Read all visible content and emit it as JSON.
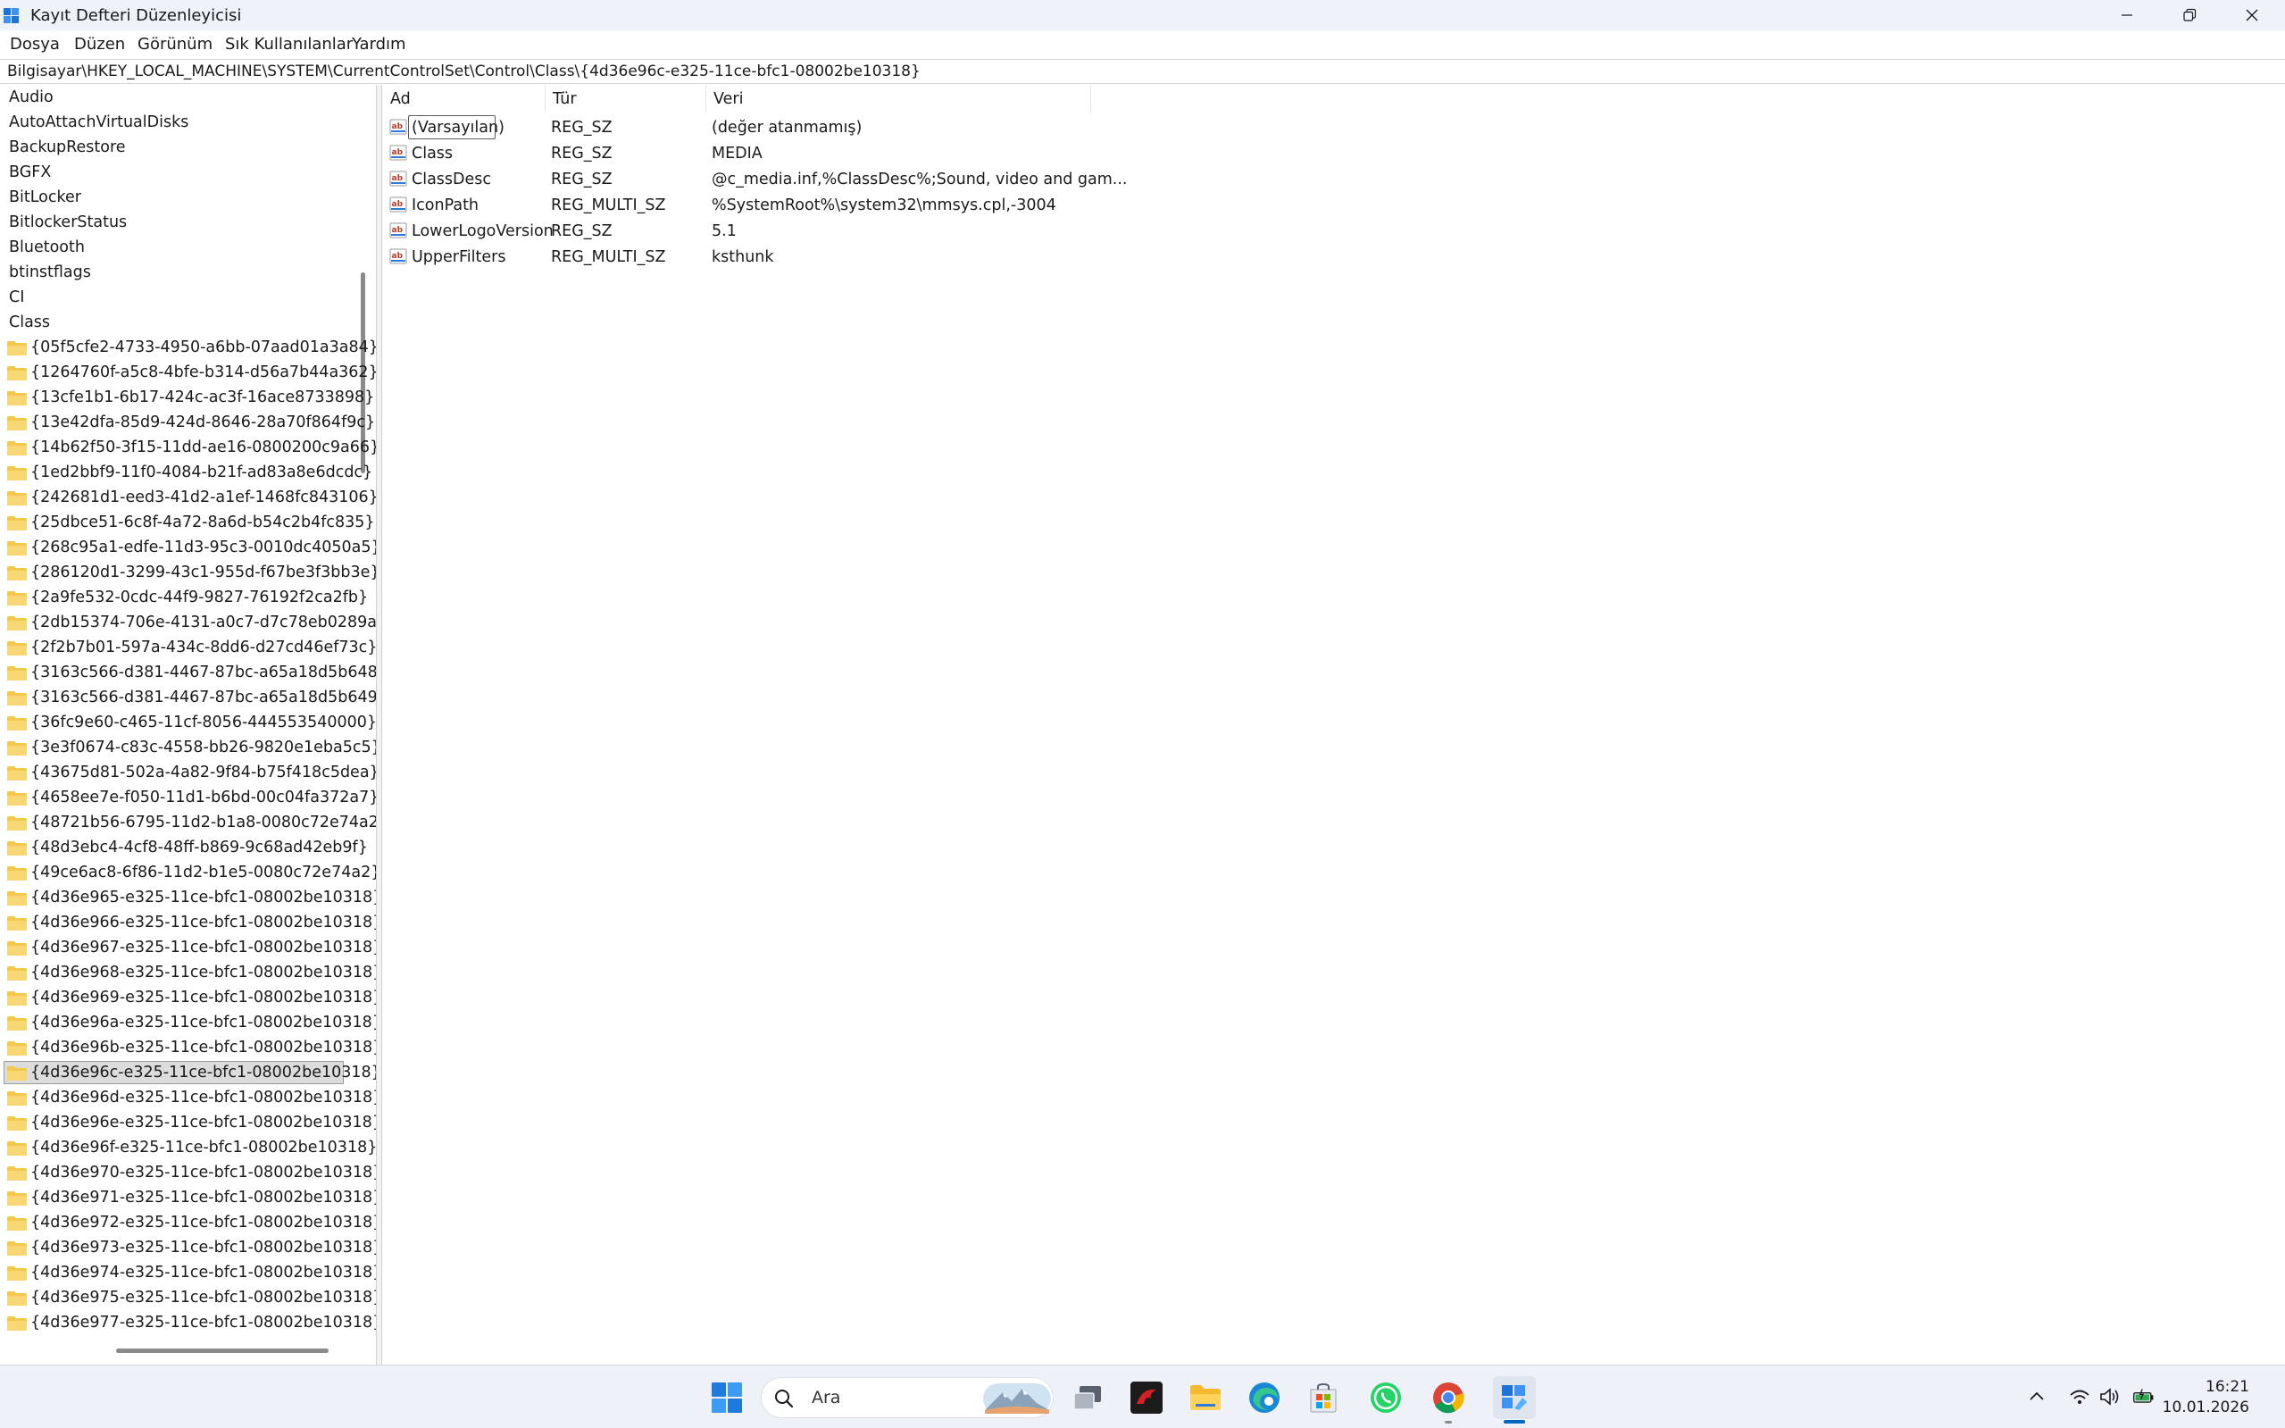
{
  "window": {
    "title": "Kayıt Defteri Düzenleyicisi"
  },
  "menu": {
    "items": [
      "Dosya",
      "Düzen",
      "Görünüm",
      "Sık Kullanılanlar",
      "Yardım"
    ]
  },
  "address": {
    "path": "Bilgisayar\\HKEY_LOCAL_MACHINE\\SYSTEM\\CurrentControlSet\\Control\\Class\\{4d36e96c-e325-11ce-bfc1-08002be10318}"
  },
  "tree": {
    "items": [
      {
        "label": "Audio"
      },
      {
        "label": "AutoAttachVirtualDisks"
      },
      {
        "label": "BackupRestore"
      },
      {
        "label": "BGFX"
      },
      {
        "label": "BitLocker"
      },
      {
        "label": "BitlockerStatus"
      },
      {
        "label": "Bluetooth"
      },
      {
        "label": "btinstflags"
      },
      {
        "label": "CI"
      },
      {
        "label": "Class"
      },
      {
        "label": "{05f5cfe2-4733-4950-a6bb-07aad01a3a84}"
      },
      {
        "label": "{1264760f-a5c8-4bfe-b314-d56a7b44a362}"
      },
      {
        "label": "{13cfe1b1-6b17-424c-ac3f-16ace8733898}"
      },
      {
        "label": "{13e42dfa-85d9-424d-8646-28a70f864f9c}"
      },
      {
        "label": "{14b62f50-3f15-11dd-ae16-0800200c9a66}"
      },
      {
        "label": "{1ed2bbf9-11f0-4084-b21f-ad83a8e6dcdc}"
      },
      {
        "label": "{242681d1-eed3-41d2-a1ef-1468fc843106}"
      },
      {
        "label": "{25dbce51-6c8f-4a72-8a6d-b54c2b4fc835}"
      },
      {
        "label": "{268c95a1-edfe-11d3-95c3-0010dc4050a5}"
      },
      {
        "label": "{286120d1-3299-43c1-955d-f67be3f3bb3e}"
      },
      {
        "label": "{2a9fe532-0cdc-44f9-9827-76192f2ca2fb}"
      },
      {
        "label": "{2db15374-706e-4131-a0c7-d7c78eb0289a}"
      },
      {
        "label": "{2f2b7b01-597a-434c-8dd6-d27cd46ef73c}"
      },
      {
        "label": "{3163c566-d381-4467-87bc-a65a18d5b648}"
      },
      {
        "label": "{3163c566-d381-4467-87bc-a65a18d5b649}"
      },
      {
        "label": "{36fc9e60-c465-11cf-8056-444553540000}"
      },
      {
        "label": "{3e3f0674-c83c-4558-bb26-9820e1eba5c5}"
      },
      {
        "label": "{43675d81-502a-4a82-9f84-b75f418c5dea}"
      },
      {
        "label": "{4658ee7e-f050-11d1-b6bd-00c04fa372a7}"
      },
      {
        "label": "{48721b56-6795-11d2-b1a8-0080c72e74a2}"
      },
      {
        "label": "{48d3ebc4-4cf8-48ff-b869-9c68ad42eb9f}"
      },
      {
        "label": "{49ce6ac8-6f86-11d2-b1e5-0080c72e74a2}"
      },
      {
        "label": "{4d36e965-e325-11ce-bfc1-08002be10318}"
      },
      {
        "label": "{4d36e966-e325-11ce-bfc1-08002be10318}"
      },
      {
        "label": "{4d36e967-e325-11ce-bfc1-08002be10318}"
      },
      {
        "label": "{4d36e968-e325-11ce-bfc1-08002be10318}"
      },
      {
        "label": "{4d36e969-e325-11ce-bfc1-08002be10318}"
      },
      {
        "label": "{4d36e96a-e325-11ce-bfc1-08002be10318}"
      },
      {
        "label": "{4d36e96b-e325-11ce-bfc1-08002be10318}"
      },
      {
        "label": "{4d36e96c-e325-11ce-bfc1-08002be10318}"
      },
      {
        "label": "{4d36e96d-e325-11ce-bfc1-08002be10318}"
      },
      {
        "label": "{4d36e96e-e325-11ce-bfc1-08002be10318}"
      },
      {
        "label": "{4d36e96f-e325-11ce-bfc1-08002be10318}"
      },
      {
        "label": "{4d36e970-e325-11ce-bfc1-08002be10318}"
      },
      {
        "label": "{4d36e971-e325-11ce-bfc1-08002be10318}"
      },
      {
        "label": "{4d36e972-e325-11ce-bfc1-08002be10318}"
      },
      {
        "label": "{4d36e973-e325-11ce-bfc1-08002be10318}"
      },
      {
        "label": "{4d36e974-e325-11ce-bfc1-08002be10318}"
      },
      {
        "label": "{4d36e975-e325-11ce-bfc1-08002be10318}"
      },
      {
        "label": "{4d36e977-e325-11ce-bfc1-08002be10318}"
      }
    ],
    "selected_label": "{4d36e96c-e325-11ce-bfc1-08002be10318}"
  },
  "list": {
    "columns": [
      "Ad",
      "Tür",
      "Veri"
    ],
    "rows": [
      {
        "name": "(Varsayılan)",
        "type": "REG_SZ",
        "data": "(değer atanmamış)"
      },
      {
        "name": "Class",
        "type": "REG_SZ",
        "data": "MEDIA"
      },
      {
        "name": "ClassDesc",
        "type": "REG_SZ",
        "data": "@c_media.inf,%ClassDesc%;Sound, video and gam..."
      },
      {
        "name": "IconPath",
        "type": "REG_MULTI_SZ",
        "data": "%SystemRoot%\\system32\\mmsys.cpl,-3004"
      },
      {
        "name": "LowerLogoVersion",
        "type": "REG_SZ",
        "data": "5.1"
      },
      {
        "name": "UpperFilters",
        "type": "REG_MULTI_SZ",
        "data": "ksthunk"
      }
    ]
  },
  "taskbar": {
    "search_label": "Ara",
    "time": "16:21",
    "date": "10.01.2026"
  },
  "colors": {
    "accent": "#0067c0",
    "folder": "#f2c94c",
    "selection": "#dcdcdc"
  }
}
